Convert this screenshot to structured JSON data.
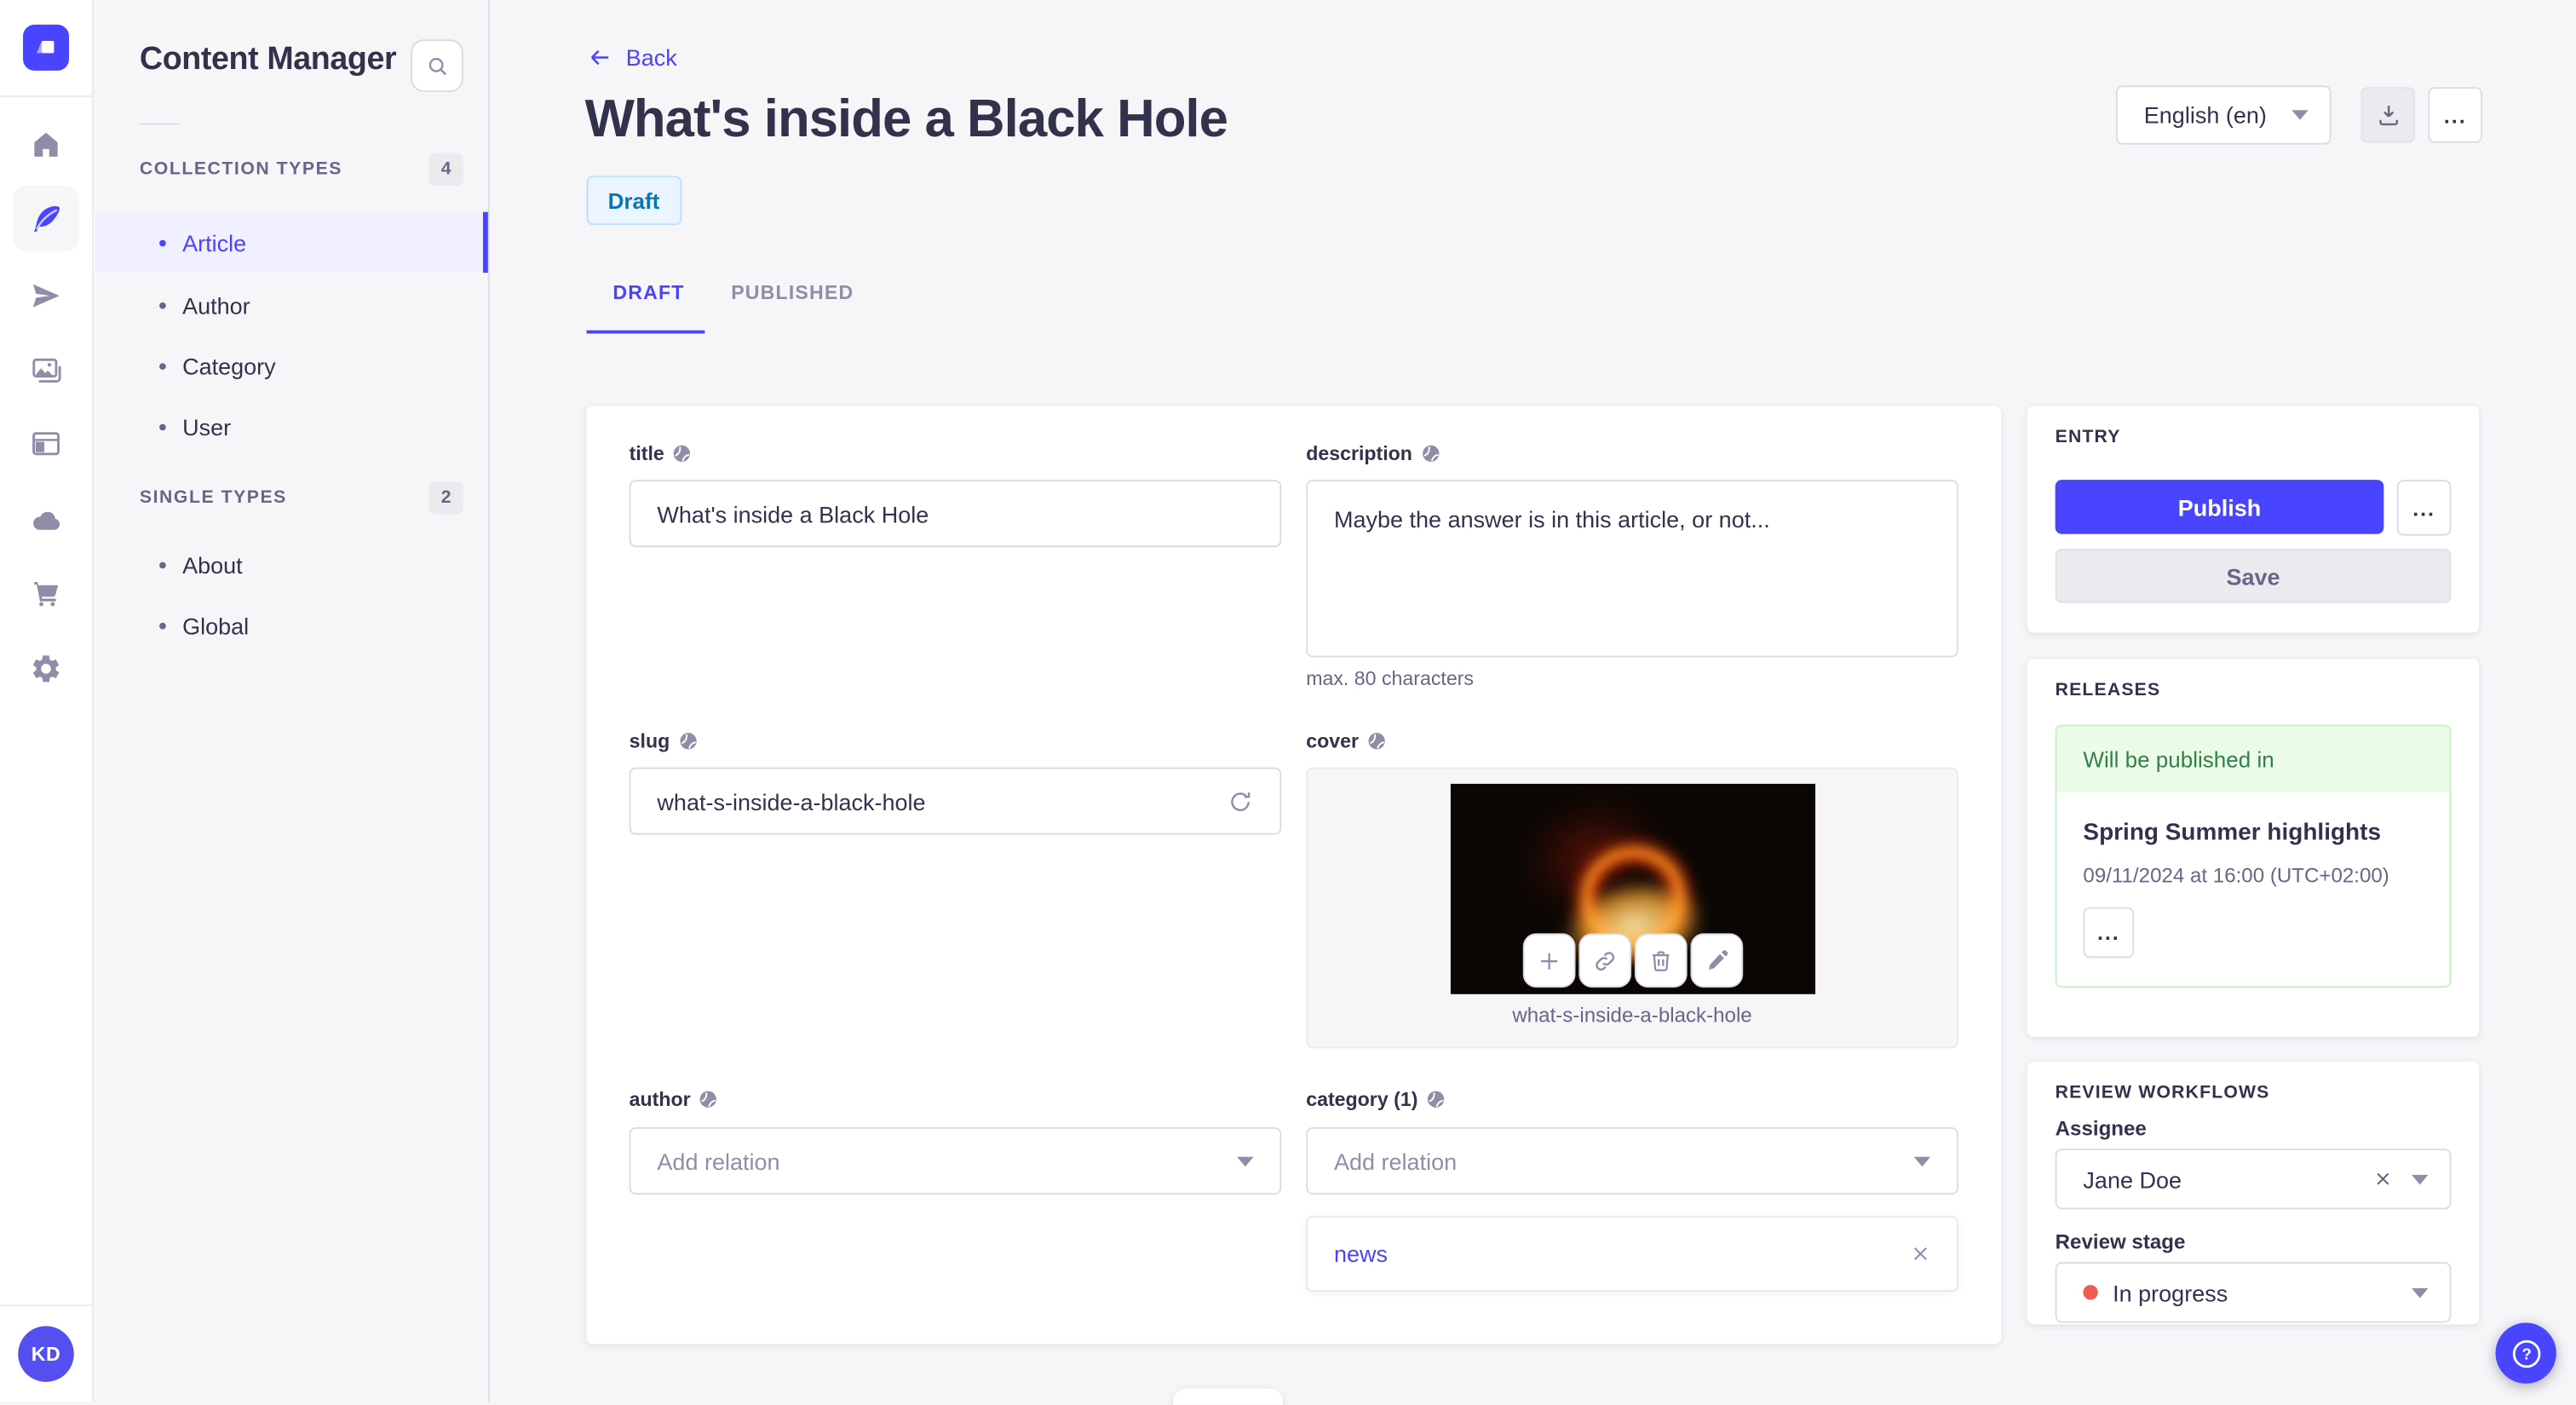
{
  "colors": {
    "accent": "#4945ff",
    "danger": "#ee5e52",
    "success_text": "#328048",
    "success_bg": "#eafbe7",
    "draft_text": "#0c75af",
    "draft_bg": "#eaf5ff",
    "icon_grey": "#8e8ea9"
  },
  "rail": {
    "logo_icon": "strapi-logo",
    "nav_icons": [
      "home-icon",
      "feather-icon",
      "paper-plane-icon",
      "media-library-icon",
      "layout-icon",
      "cloud-icon",
      "cart-icon",
      "settings-icon"
    ],
    "avatar_initials": "KD"
  },
  "sidebar": {
    "title": "Content Manager",
    "search_icon": "search-icon",
    "sections": [
      {
        "label": "COLLECTION TYPES",
        "badge": "4",
        "items": [
          "Article",
          "Author",
          "Category",
          "User"
        ],
        "active_item": "Article"
      },
      {
        "label": "SINGLE TYPES",
        "badge": "2",
        "items": [
          "About",
          "Global"
        ]
      }
    ]
  },
  "header": {
    "back_label": "Back",
    "title": "What's inside a Black Hole",
    "status_badge": "Draft",
    "locale": "English (en)",
    "more_label": "...",
    "entry_more_label": "...",
    "release_more_label": "..."
  },
  "tabs": {
    "draft": "DRAFT",
    "published": "PUBLISHED"
  },
  "form": {
    "title": {
      "label": "title",
      "value": "What's inside a Black Hole"
    },
    "description": {
      "label": "description",
      "value": "Maybe the answer is in this article, or not...",
      "helper": "max. 80 characters"
    },
    "slug": {
      "label": "slug",
      "value": "what-s-inside-a-black-hole"
    },
    "cover": {
      "label": "cover",
      "caption": "what-s-inside-a-black-hole"
    },
    "author": {
      "label": "author",
      "placeholder": "Add relation"
    },
    "category": {
      "label": "category (1)",
      "placeholder": "Add relation",
      "relations": [
        "news"
      ]
    }
  },
  "entry_panel": {
    "heading": "ENTRY",
    "publish_label": "Publish",
    "save_label": "Save"
  },
  "releases_panel": {
    "heading": "RELEASES",
    "status": "Will be published in",
    "release_name": "Spring Summer highlights",
    "release_date": "09/11/2024 at 16:00 (UTC+02:00)"
  },
  "review_panel": {
    "heading": "REVIEW WORKFLOWS",
    "assignee_label": "Assignee",
    "assignee_value": "Jane Doe",
    "stage_label": "Review stage",
    "stage_value": "In progress"
  }
}
